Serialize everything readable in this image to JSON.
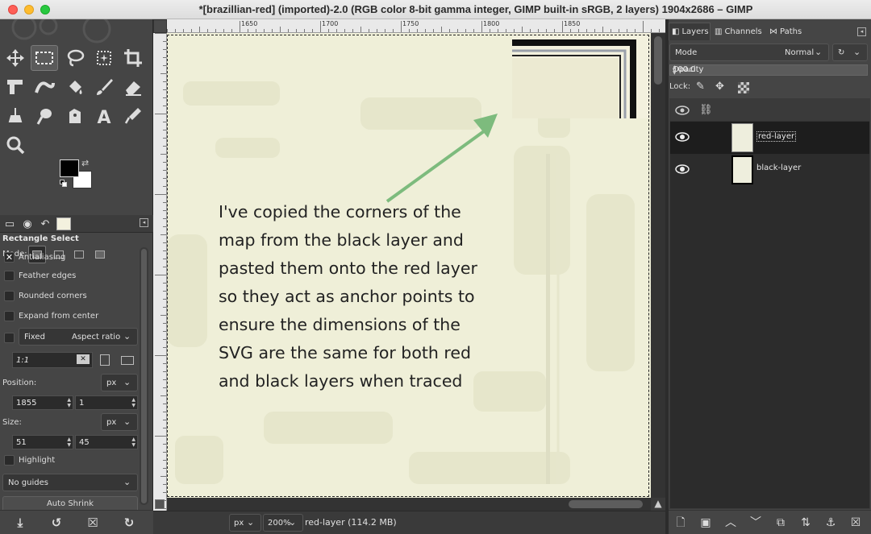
{
  "window": {
    "title": "*[brazillian-red] (imported)-2.0 (RGB color 8-bit gamma integer, GIMP built-in sRGB, 2 layers) 1904x2686 – GIMP"
  },
  "toolbox": {
    "tools": [
      "move-tool",
      "rectangle-select-tool",
      "lasso-tool",
      "fuzzy-select-tool",
      "crop-tool",
      "unified-transform-tool",
      "warp-tool",
      "bucket-fill-tool",
      "paintbrush-tool",
      "eraser-tool",
      "clone-tool",
      "smudge-tool",
      "paths-tool",
      "text-tool",
      "color-picker-tool",
      "zoom-tool"
    ],
    "fg_color": "#000000",
    "bg_color": "#ffffff"
  },
  "tool_options": {
    "title": "Rectangle Select",
    "mode_label": "Mode:",
    "antialiasing": "Antialiasing",
    "feather_edges": "Feather edges",
    "rounded_corners": "Rounded corners",
    "expand_from_center": "Expand from center",
    "fixed_label": "Fixed",
    "fixed_option": "Aspect ratio",
    "ratio_value": "1:1",
    "position_label": "Position:",
    "position_unit": "px",
    "position_x": "1855",
    "position_y": "1",
    "size_label": "Size:",
    "size_unit": "px",
    "size_w": "51",
    "size_h": "45",
    "highlight": "Highlight",
    "guides": "No guides",
    "auto_shrink": "Auto Shrink"
  },
  "ruler": {
    "labels": [
      "1650",
      "1700",
      "1750",
      "1800",
      "1850"
    ]
  },
  "canvas": {
    "annotation_lines": [
      "I've copied the corners of the",
      "map from the black layer and",
      "pasted them onto the red layer",
      "so they act as anchor points to",
      "ensure the dimensions of the",
      "SVG are the same for both red",
      "and black layers when traced"
    ],
    "arrow_color": "#7dbb7d",
    "background_color": "#efefd8"
  },
  "status": {
    "unit": "px",
    "zoom": "200%",
    "layer_info": "red-layer (114.2 MB)"
  },
  "layers_panel": {
    "tabs": [
      "Layers",
      "Channels",
      "Paths"
    ],
    "mode_label": "Mode",
    "mode_value": "Normal",
    "opacity_label": "Opacity",
    "opacity_value": "100.0",
    "lock_label": "Lock:",
    "layers": [
      {
        "name": "red-layer",
        "visible": true,
        "selected": true
      },
      {
        "name": "black-layer",
        "visible": true,
        "selected": false
      }
    ]
  }
}
